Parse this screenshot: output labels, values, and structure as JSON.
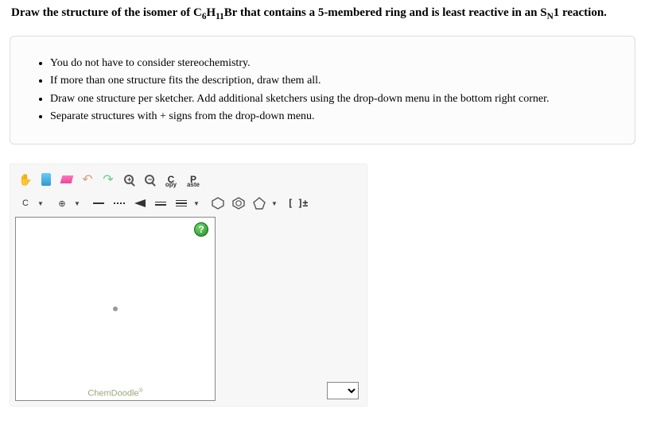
{
  "prompt": {
    "pre": "Draw the structure of the isomer of C",
    "sub1": "6",
    "mid1": "H",
    "sub2": "11",
    "mid2": "Br that contains a 5-membered ring and is least reactive in an S",
    "sub3": "N",
    "post": "1 reaction."
  },
  "instructions": [
    "You do not have to consider stereochemistry.",
    "If more than one structure fits the description, draw them all.",
    "Draw one structure per sketcher. Add additional sketchers using the drop-down menu in the bottom right corner.",
    "Separate structures with + signs from the drop-down menu."
  ],
  "toolbar_labels": {
    "copy_c": "C",
    "copy_sub": "opy",
    "paste_p": "P",
    "paste_sub": "aste",
    "element": "C",
    "plus": "⊕",
    "charge": "[ ]±",
    "help": "?"
  },
  "brand": "ChemDoodle",
  "brand_sup": "®"
}
